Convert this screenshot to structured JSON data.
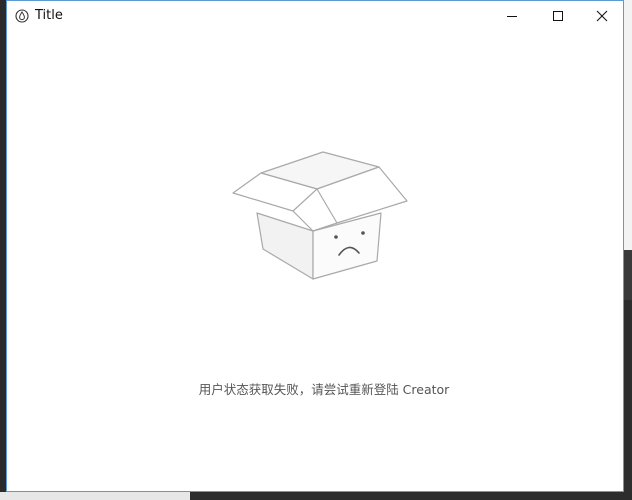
{
  "window": {
    "title": "Title",
    "controls": {
      "minimize": "minimize-icon",
      "maximize": "maximize-icon",
      "close": "close-icon"
    }
  },
  "empty_state": {
    "illustration": "sad-box-icon",
    "message": "用户状态获取失败，请尝试重新登陆 Creator"
  },
  "colors": {
    "window_border": "#5b9bd5",
    "text": "#555555",
    "illustration_stroke": "#a9a9a9"
  }
}
